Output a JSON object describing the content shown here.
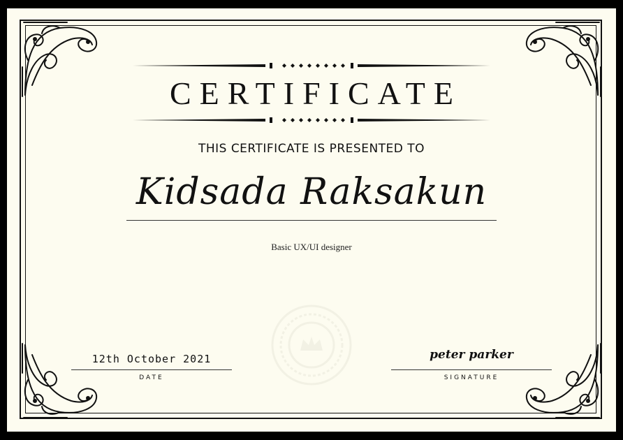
{
  "certificate": {
    "title": "CERTIFICATE",
    "presented_text": "THIS CERTIFICATE IS PRESENTED TO",
    "recipient": "Kidsada Raksakun",
    "course": "Basic UX/UI designer",
    "date_value": "12th October 2021",
    "date_label": "DATE",
    "signature_value": "peter parker",
    "signature_label": "SIGNATURE"
  },
  "colors": {
    "paper": "#fdfcf0",
    "ink": "#111111",
    "border": "#000000"
  },
  "icons": {
    "corner": "flourish-ornament-icon",
    "rule": "decorative-divider-icon",
    "seal": "watermark-seal-icon"
  }
}
